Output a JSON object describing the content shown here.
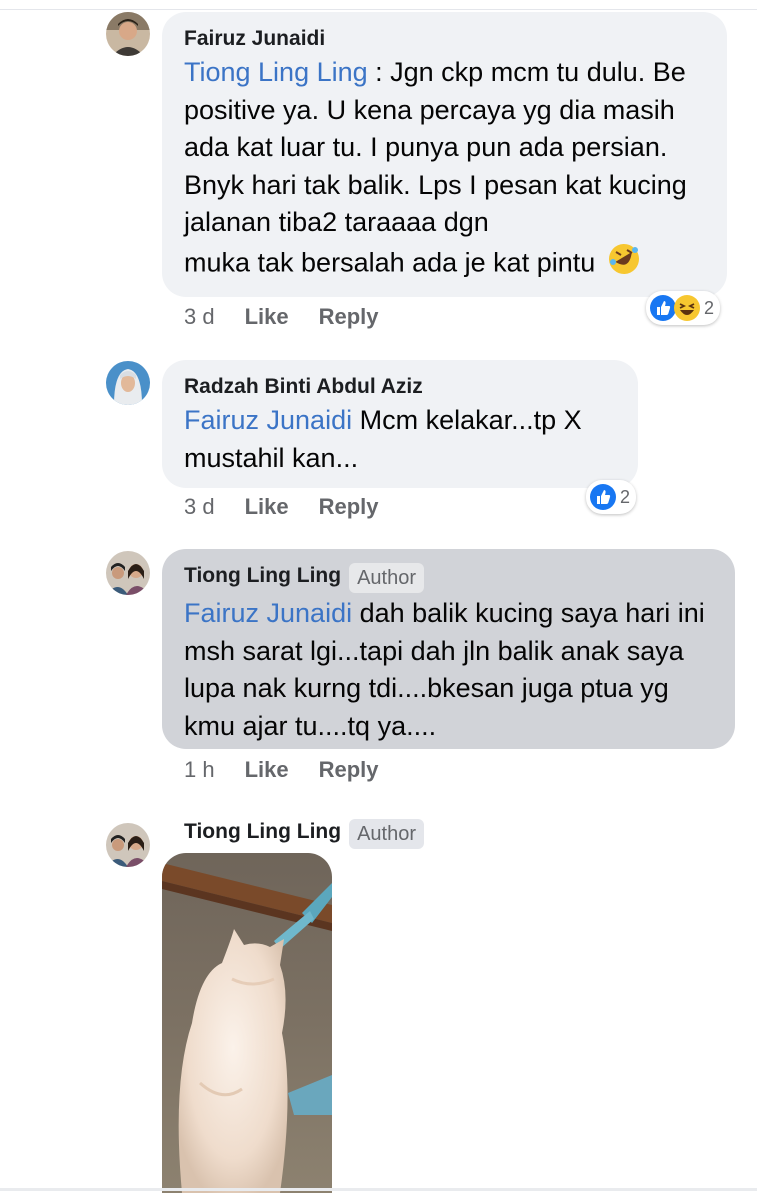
{
  "comments": [
    {
      "name": "Fairuz Junaidi",
      "mention": "Tiong Ling Ling",
      "text_1": " : Jgn ckp mcm tu dulu. Be positive ya. U kena percaya yg dia masih ada kat luar tu. I punya pun ada persian. Bnyk hari tak balik. Lps I pesan kat kucing jalanan tiba2 taraaaa dgn",
      "text_2": "muka tak bersalah ada je kat pintu",
      "time": "3 d",
      "like": "Like",
      "reply": "Reply",
      "reaction_count": "2",
      "reaction_icons": [
        "like-icon",
        "haha-icon"
      ]
    },
    {
      "name": "Radzah Binti Abdul Aziz",
      "mention": "Fairuz Junaidi",
      "text": " Mcm kelakar...tp X mustahil kan...",
      "time": "3 d",
      "like": "Like",
      "reply": "Reply",
      "reaction_count": "2",
      "reaction_icons": [
        "like-icon"
      ]
    },
    {
      "name": "Tiong Ling Ling",
      "badge": "Author",
      "mention": "Fairuz Junaidi",
      "text": " dah balik kucing saya hari ini msh sarat lgi...tapi dah jln balik anak saya lupa nak kurng tdi....bkesan juga ptua yg kmu ajar tu....tq ya....",
      "time": "1 h",
      "like": "Like",
      "reply": "Reply"
    },
    {
      "name": "Tiong Ling Ling",
      "badge": "Author",
      "image_subject": "white persian cat photo"
    }
  ],
  "colors": {
    "mention": "#3b74c6",
    "bubble": "#f0f2f5",
    "author_bubble": "#d1d3d8",
    "like_blue": "#1877f2"
  }
}
